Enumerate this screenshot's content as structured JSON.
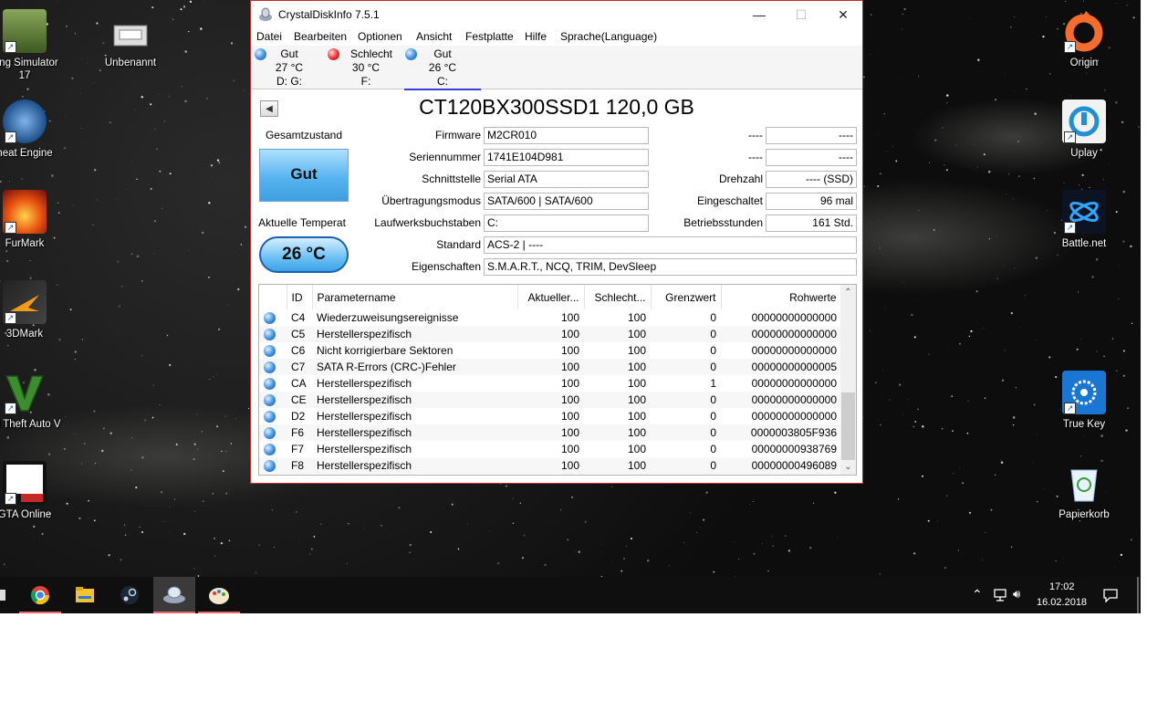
{
  "desktop": {
    "left_icons": [
      {
        "label": "ning Simulator",
        "label2": "17",
        "icon": "farming-simulator-icon",
        "color": "#4b6b2a"
      },
      {
        "label": "heat Engine",
        "icon": "cheat-engine-icon",
        "color": "#2a6fb8"
      },
      {
        "label": "FurMark",
        "icon": "furmark-icon",
        "color": "#c0392b"
      },
      {
        "label": "3DMark",
        "icon": "3dmark-icon",
        "color": "#e67e22"
      },
      {
        "label": "nd Theft Auto V",
        "icon": "gta-v-icon",
        "color": "#2e7d32"
      },
      {
        "label": "GTA Online",
        "icon": "gta-online-icon",
        "color": "#c62828"
      }
    ],
    "unbenannt": {
      "label": "Unbenannt",
      "icon": "device-icon"
    },
    "right_icons": [
      {
        "label": "Origin",
        "icon": "origin-icon",
        "color": "#f56c2d"
      },
      {
        "label": "Uplay",
        "icon": "uplay-icon",
        "color": "#1f8fd6"
      },
      {
        "label": "Battle.net",
        "icon": "battlenet-icon",
        "color": "#148eff"
      },
      {
        "label": "True Key",
        "icon": "truekey-icon",
        "color": "#1976d2"
      },
      {
        "label": "Papierkorb",
        "icon": "recycle-bin-icon",
        "color": "#9ec9e8"
      }
    ]
  },
  "window": {
    "title": "CrystalDiskInfo 7.5.1",
    "buttons": {
      "minimize": "—",
      "maximize": "☐",
      "close": "✕"
    },
    "menu": [
      "Datei",
      "Bearbeiten",
      "Optionen",
      "Ansicht",
      "Festplatte",
      "Hilfe",
      "Sprache(Language)"
    ],
    "drives": [
      {
        "status": "Gut",
        "temp": "27 °C",
        "letters": "D: G:",
        "color": "blue"
      },
      {
        "status": "Schlecht",
        "temp": "30 °C",
        "letters": "F:",
        "color": "red"
      },
      {
        "status": "Gut",
        "temp": "26 °C",
        "letters": "C:",
        "color": "blue"
      }
    ],
    "model": "CT120BX300SSD1 120,0 GB",
    "health_label": "Gesamtzustand",
    "health_value": "Gut",
    "temp_label": "Aktuelle Temperat",
    "temp_value": "26 °C",
    "fields_left": [
      {
        "label": "Firmware",
        "value": "M2CR010"
      },
      {
        "label": "Seriennummer",
        "value": "1741E104D981"
      },
      {
        "label": "Schnittstelle",
        "value": "Serial ATA"
      },
      {
        "label": "Übertragungsmodus",
        "value": "SATA/600 | SATA/600"
      },
      {
        "label": "Laufwerksbuchstaben",
        "value": "C:"
      }
    ],
    "fields_right": [
      {
        "label": "----",
        "value": "----"
      },
      {
        "label": "----",
        "value": "----"
      },
      {
        "label": "Drehzahl",
        "value": "---- (SSD)"
      },
      {
        "label": "Eingeschaltet",
        "value": "96 mal"
      },
      {
        "label": "Betriebsstunden",
        "value": "161 Std."
      }
    ],
    "standard": {
      "label": "Standard",
      "value": "ACS-2 | ----"
    },
    "features": {
      "label": "Eigenschaften",
      "value": "S.M.A.R.T., NCQ, TRIM, DevSleep"
    },
    "smart": {
      "headers": [
        "ID",
        "Parametername",
        "Aktueller...",
        "Schlecht...",
        "Grenzwert",
        "Rohwerte"
      ],
      "rows": [
        [
          "C4",
          "Wiederzuweisungsereignisse",
          "100",
          "100",
          "0",
          "00000000000000"
        ],
        [
          "C5",
          "Herstellerspezifisch",
          "100",
          "100",
          "0",
          "00000000000000"
        ],
        [
          "C6",
          "Nicht korrigierbare Sektoren",
          "100",
          "100",
          "0",
          "00000000000000"
        ],
        [
          "C7",
          "SATA R-Errors (CRC-)Fehler",
          "100",
          "100",
          "0",
          "00000000000005"
        ],
        [
          "CA",
          "Herstellerspezifisch",
          "100",
          "100",
          "1",
          "00000000000000"
        ],
        [
          "CE",
          "Herstellerspezifisch",
          "100",
          "100",
          "0",
          "00000000000000"
        ],
        [
          "D2",
          "Herstellerspezifisch",
          "100",
          "100",
          "0",
          "00000000000000"
        ],
        [
          "F6",
          "Herstellerspezifisch",
          "100",
          "100",
          "0",
          "0000003805F936"
        ],
        [
          "F7",
          "Herstellerspezifisch",
          "100",
          "100",
          "0",
          "00000000938769"
        ],
        [
          "F8",
          "Herstellerspezifisch",
          "100",
          "100",
          "0",
          "00000000496089"
        ]
      ]
    }
  },
  "taskbar": {
    "apps": [
      {
        "name": "chrome-icon",
        "open": true
      },
      {
        "name": "file-explorer-icon",
        "open": false
      },
      {
        "name": "steam-icon",
        "open": false
      },
      {
        "name": "crystaldiskinfo-icon",
        "open": true,
        "active": true
      },
      {
        "name": "paint-icon",
        "open": true
      }
    ],
    "time": "17:02",
    "date": "16.02.2018"
  }
}
